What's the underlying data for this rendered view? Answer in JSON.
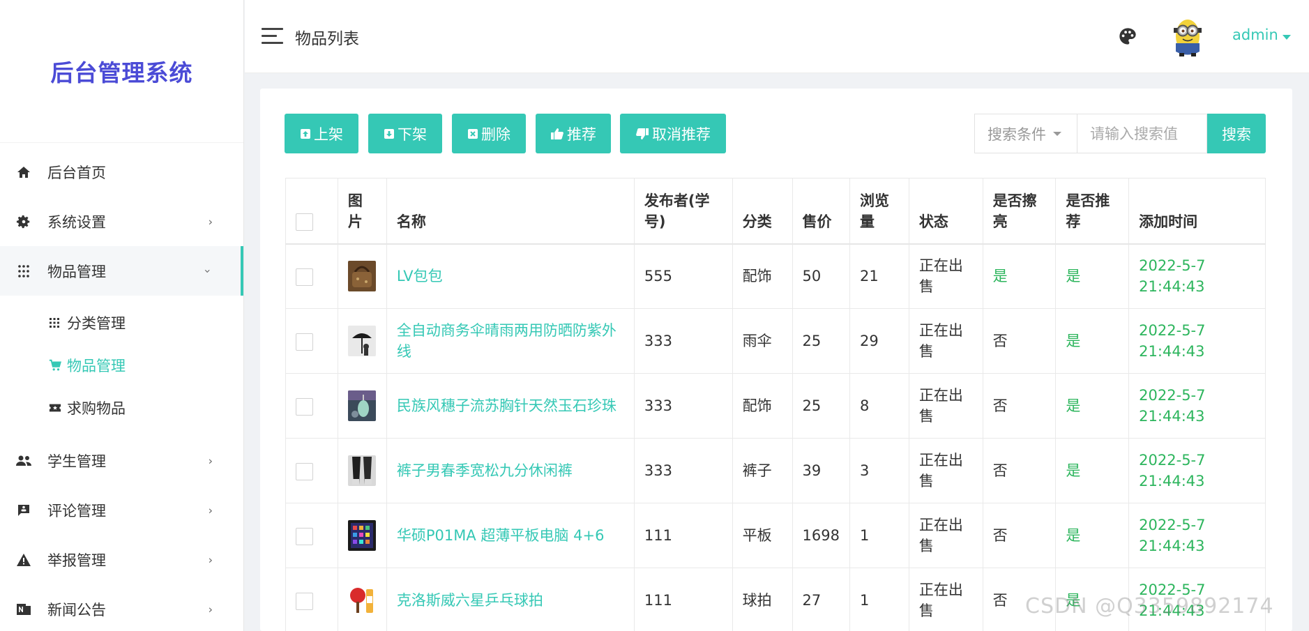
{
  "sidebar": {
    "logo": "后台管理系统",
    "items": [
      {
        "label": "后台首页",
        "icon": "home-icon"
      },
      {
        "label": "系统设置",
        "icon": "gear-icon"
      },
      {
        "label": "物品管理",
        "icon": "grid-icon"
      },
      {
        "label": "学生管理",
        "icon": "people-icon"
      },
      {
        "label": "评论管理",
        "icon": "comment-icon"
      },
      {
        "label": "举报管理",
        "icon": "warning-icon"
      },
      {
        "label": "新闻公告",
        "icon": "news-icon"
      }
    ],
    "subitems": [
      {
        "label": "分类管理",
        "icon": "apps-icon"
      },
      {
        "label": "物品管理",
        "icon": "cart-icon"
      },
      {
        "label": "求购物品",
        "icon": "ticket-icon"
      }
    ]
  },
  "header": {
    "title": "物品列表",
    "user": "admin"
  },
  "toolbar": {
    "on_shelf": "上架",
    "off_shelf": "下架",
    "delete": "删除",
    "recommend": "推荐",
    "cancel_recommend": "取消推荐",
    "search_condition": "搜索条件",
    "search_placeholder": "请输入搜索值",
    "search": "搜索"
  },
  "table": {
    "headers": {
      "image": "图片",
      "name": "名称",
      "publisher": "发布者(学号)",
      "category": "分类",
      "price": "售价",
      "views": "浏览量",
      "status": "状态",
      "polished": "是否擦亮",
      "recommended": "是否推荐",
      "added": "添加时间"
    },
    "rows": [
      {
        "name": "LV包包",
        "publisher": "555",
        "category": "配饰",
        "price": "50",
        "views": "21",
        "status": "正在出售",
        "polished": "是",
        "recommended": "是",
        "date": "2022-5-7",
        "time": "21:44:43"
      },
      {
        "name": "全自动商务伞晴雨两用防晒防紫外线",
        "publisher": "333",
        "category": "雨伞",
        "price": "25",
        "views": "29",
        "status": "正在出售",
        "polished": "否",
        "recommended": "是",
        "date": "2022-5-7",
        "time": "21:44:43"
      },
      {
        "name": "民族风穗子流苏胸针天然玉石珍珠",
        "publisher": "333",
        "category": "配饰",
        "price": "25",
        "views": "8",
        "status": "正在出售",
        "polished": "否",
        "recommended": "是",
        "date": "2022-5-7",
        "time": "21:44:43"
      },
      {
        "name": "裤子男春季宽松九分休闲裤",
        "publisher": "333",
        "category": "裤子",
        "price": "39",
        "views": "3",
        "status": "正在出售",
        "polished": "否",
        "recommended": "是",
        "date": "2022-5-7",
        "time": "21:44:43"
      },
      {
        "name": "华硕P01MA 超薄平板电脑 4+6",
        "publisher": "111",
        "category": "平板",
        "price": "1698",
        "views": "1",
        "status": "正在出售",
        "polished": "否",
        "recommended": "是",
        "date": "2022-5-7",
        "time": "21:44:43"
      },
      {
        "name": "克洛斯威六星乒乓球拍",
        "publisher": "111",
        "category": "球拍",
        "price": "27",
        "views": "1",
        "status": "正在出售",
        "polished": "否",
        "recommended": "是",
        "date": "2022-5-7",
        "time": "21:44:43"
      }
    ]
  },
  "watermark": "CSDN @Q3359892174",
  "colors": {
    "accent": "#35c8b5",
    "logo": "#4b4bd6",
    "status_green": "#2db55d"
  }
}
